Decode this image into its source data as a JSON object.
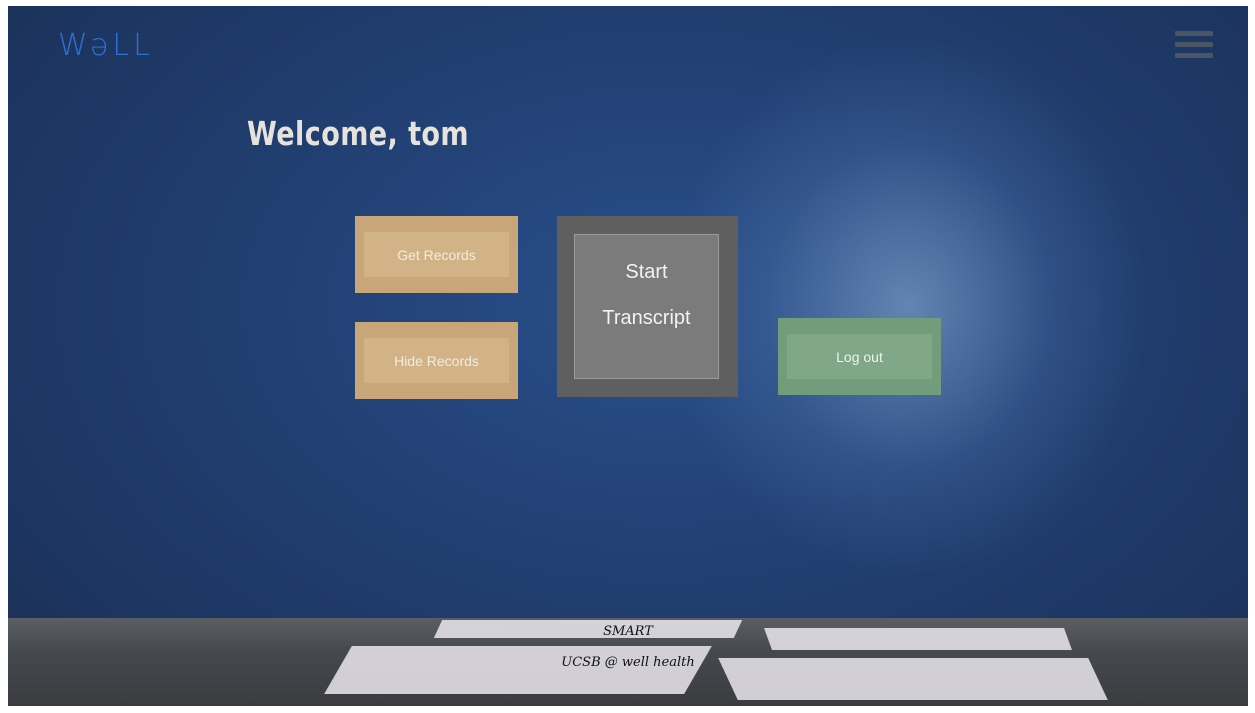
{
  "header": {
    "logo_text": "WəLL",
    "menu_icon": "hamburger-menu-icon"
  },
  "main": {
    "welcome_text": "Welcome, tom",
    "buttons": {
      "get_records": "Get Records",
      "hide_records": "Hide Records",
      "start_transcript_line1": "Start",
      "start_transcript_line2": "Transcript",
      "log_out": "Log out"
    }
  },
  "footer": {
    "line1": "SMART",
    "line2": "UCSB @ well health"
  },
  "colors": {
    "logo": "#2f6fd6",
    "tan_button": "#c9a57a",
    "gray_button": "#5f5f5f",
    "green_button": "#739c7c",
    "background": "#213f72"
  }
}
